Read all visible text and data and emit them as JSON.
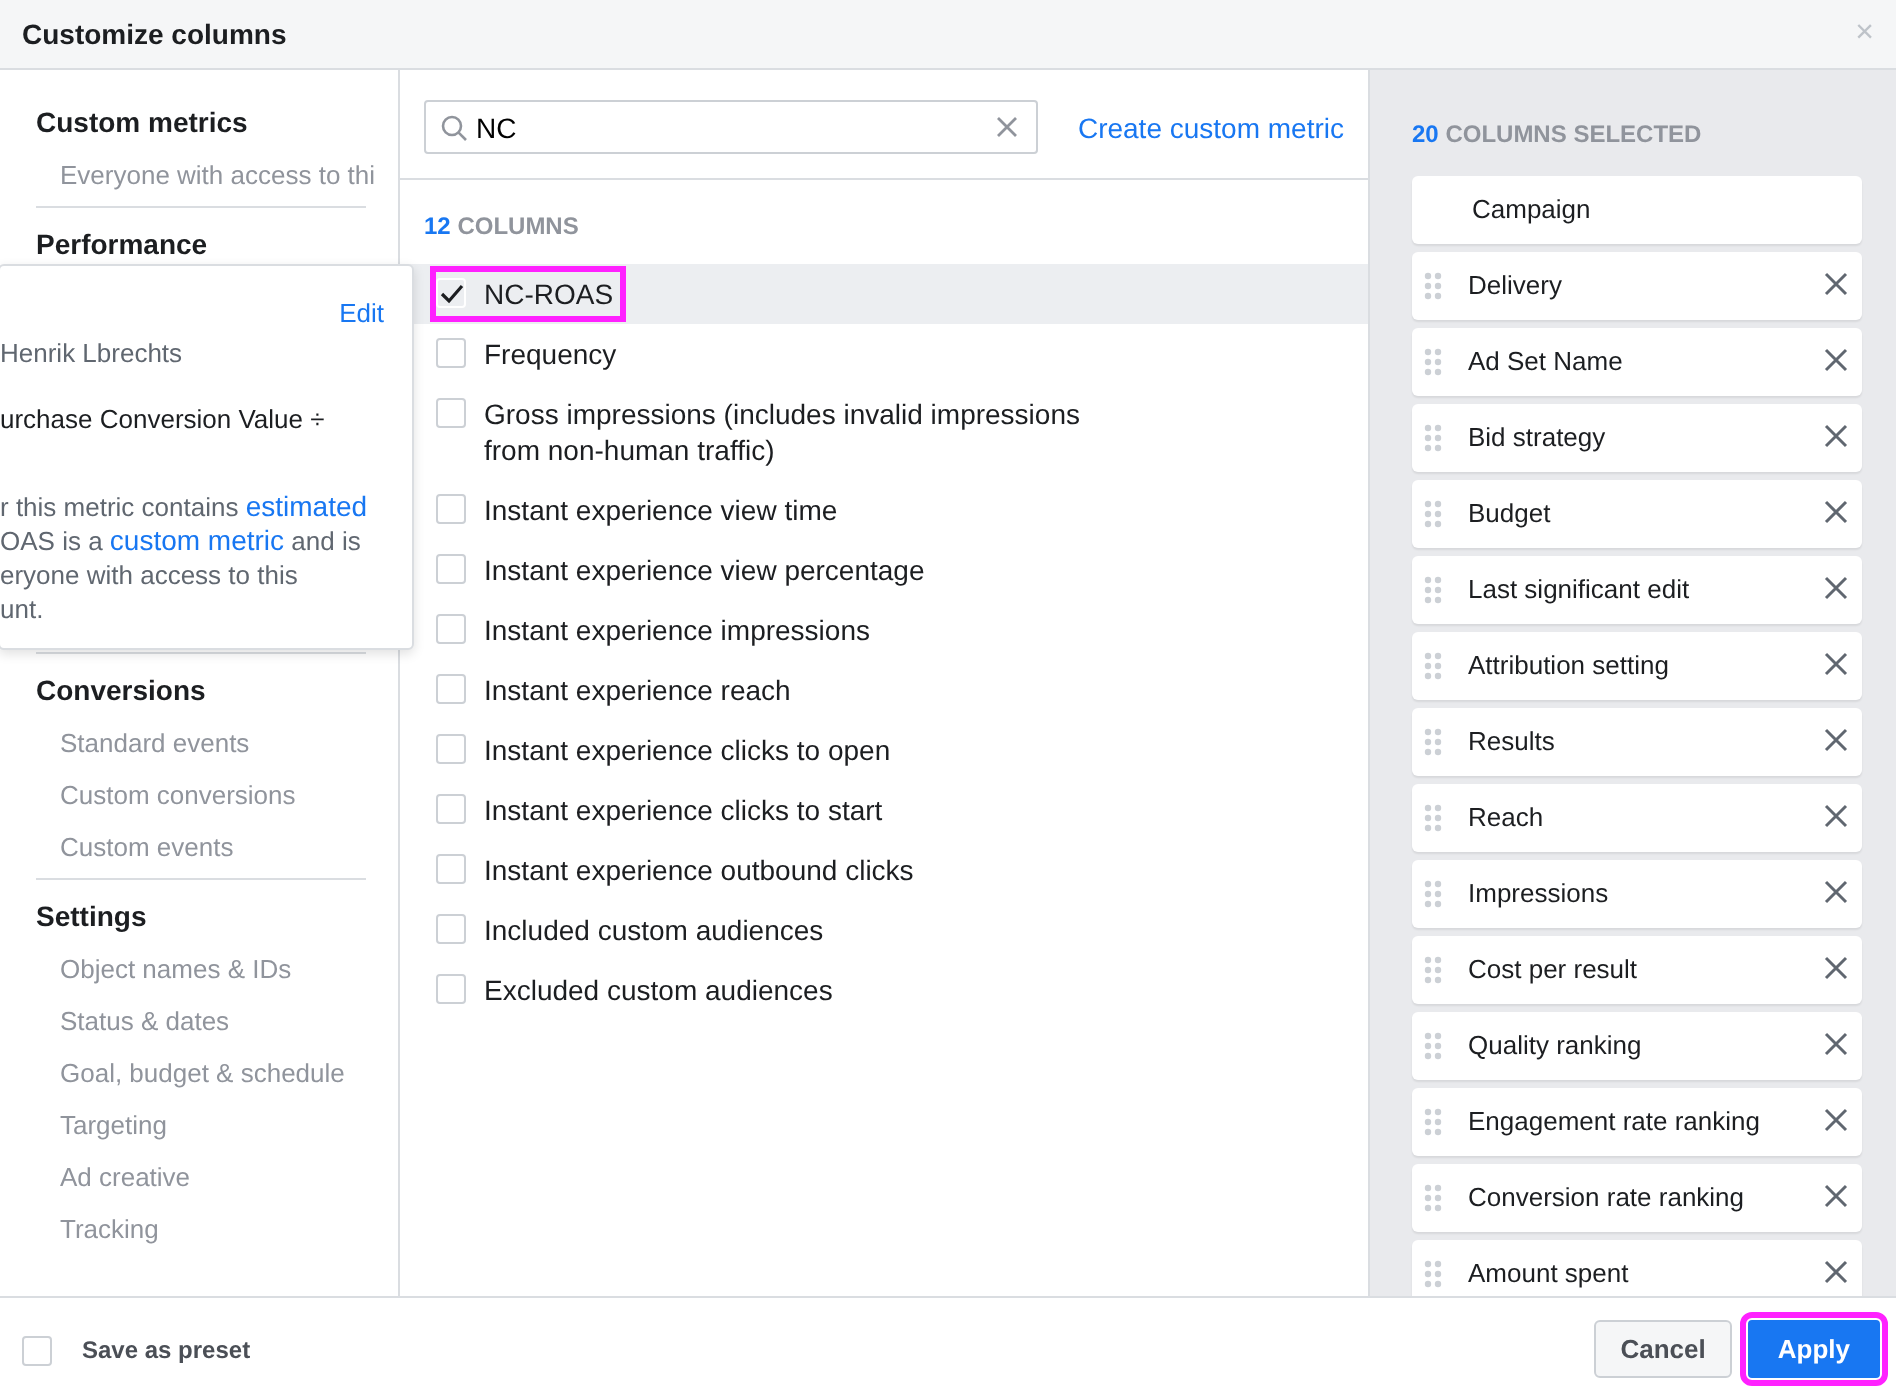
{
  "dialog": {
    "title": "Customize columns",
    "close_label": "×"
  },
  "sidebar": {
    "sections": [
      {
        "heading": "Custom metrics",
        "items": [
          "Everyone with access to thi"
        ]
      },
      {
        "heading": "Performance"
      },
      {
        "heading": "Conversions",
        "items": [
          "Standard events",
          "Custom conversions",
          "Custom events"
        ]
      },
      {
        "heading": "Settings",
        "items": [
          "Object names & IDs",
          "Status & dates",
          "Goal, budget & schedule",
          "Targeting",
          "Ad creative",
          "Tracking"
        ]
      }
    ]
  },
  "tooltip": {
    "edit": "Edit",
    "author": "Henrik Lbrechts",
    "formula": "urchase Conversion Value ÷",
    "note_lines": [
      [
        {
          "kind": "text",
          "text": "r this metric contains "
        },
        {
          "kind": "link",
          "text": "estimated"
        }
      ],
      [
        {
          "kind": "text",
          "text": "OAS is a "
        },
        {
          "kind": "link",
          "text": "custom metric"
        },
        {
          "kind": "text",
          "text": " and is"
        }
      ],
      [
        {
          "kind": "text",
          "text": "eryone with access to this"
        }
      ],
      [
        {
          "kind": "text",
          "text": "unt."
        }
      ]
    ]
  },
  "search": {
    "value": "NC",
    "create_link": "Create custom metric"
  },
  "results": {
    "count": "12",
    "label": "COLUMNS",
    "items": [
      {
        "label": "NC-ROAS",
        "checked": true,
        "selected": true,
        "highlighted": true
      },
      {
        "label": "Frequency",
        "checked": false,
        "selected": false,
        "highlighted": false
      },
      {
        "label": "Gross impressions (includes invalid impressions from non-human traffic)",
        "checked": false,
        "selected": false,
        "highlighted": false
      },
      {
        "label": "Instant experience view time",
        "checked": false,
        "selected": false,
        "highlighted": false
      },
      {
        "label": "Instant experience view percentage",
        "checked": false,
        "selected": false,
        "highlighted": false
      },
      {
        "label": "Instant experience impressions",
        "checked": false,
        "selected": false,
        "highlighted": false
      },
      {
        "label": "Instant experience reach",
        "checked": false,
        "selected": false,
        "highlighted": false
      },
      {
        "label": "Instant experience clicks to open",
        "checked": false,
        "selected": false,
        "highlighted": false
      },
      {
        "label": "Instant experience clicks to start",
        "checked": false,
        "selected": false,
        "highlighted": false
      },
      {
        "label": "Instant experience outbound clicks",
        "checked": false,
        "selected": false,
        "highlighted": false
      },
      {
        "label": "Included custom audiences",
        "checked": false,
        "selected": false,
        "highlighted": false
      },
      {
        "label": "Excluded custom audiences",
        "checked": false,
        "selected": false,
        "highlighted": false
      }
    ]
  },
  "selected_columns": {
    "count": "20",
    "label": "COLUMNS SELECTED",
    "items": [
      {
        "label": "Campaign",
        "kind": "fixed"
      },
      {
        "label": "Delivery",
        "kind": "movable"
      },
      {
        "label": "Ad Set Name",
        "kind": "movable"
      },
      {
        "label": "Bid strategy",
        "kind": "movable"
      },
      {
        "label": "Budget",
        "kind": "movable"
      },
      {
        "label": "Last significant edit",
        "kind": "movable"
      },
      {
        "label": "Attribution setting",
        "kind": "movable"
      },
      {
        "label": "Results",
        "kind": "movable"
      },
      {
        "label": "Reach",
        "kind": "movable"
      },
      {
        "label": "Impressions",
        "kind": "movable"
      },
      {
        "label": "Cost per result",
        "kind": "movable"
      },
      {
        "label": "Quality ranking",
        "kind": "movable"
      },
      {
        "label": "Engagement rate ranking",
        "kind": "movable"
      },
      {
        "label": "Conversion rate ranking",
        "kind": "movable"
      },
      {
        "label": "Amount spent",
        "kind": "movable"
      }
    ]
  },
  "footer": {
    "preset": {
      "label": "Save as preset",
      "checked": false
    },
    "buttons": [
      {
        "label": "Cancel",
        "kind": "secondary",
        "highlighted": false
      },
      {
        "label": "Apply",
        "kind": "primary",
        "highlighted": true
      }
    ]
  }
}
